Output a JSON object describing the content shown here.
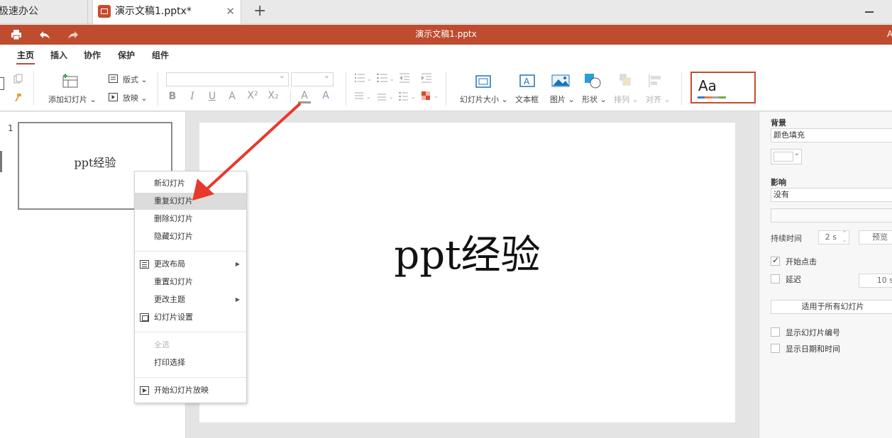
{
  "tabs": {
    "home_label": "极速办公",
    "doc_label": "演示文稿1.pptx*",
    "close_glyph": "✕",
    "add_glyph": "+"
  },
  "titlebar": {
    "title": "演示文稿1.pptx",
    "account_initial": "A",
    "color": "#bf4c2e"
  },
  "ribbon": {
    "tabs": [
      "主页",
      "插入",
      "协作",
      "保护",
      "组件"
    ],
    "active_tab": "主页"
  },
  "toolbar": {
    "add_slide": "添加幻灯片",
    "layout": "版式",
    "slideshow": "放映",
    "slide_size": "幻灯片大小",
    "text_box": "文本框",
    "picture": "图片",
    "shape": "形状",
    "arrange": "排列",
    "align": "对齐",
    "theme_text": "Aa"
  },
  "thumbnails": [
    {
      "number": "1",
      "text": "ppt经验"
    }
  ],
  "slide": {
    "text": "ppt经验"
  },
  "context_menu": {
    "items": [
      {
        "label": "新幻灯片"
      },
      {
        "label": "重复幻灯片",
        "highlighted": true
      },
      {
        "label": "删除幻灯片"
      },
      {
        "label": "隐藏幻灯片"
      },
      {
        "label": "更改布局",
        "icon": "layout-icon",
        "submenu": true
      },
      {
        "label": "重置幻灯片"
      },
      {
        "label": "更改主题",
        "submenu": true
      },
      {
        "label": "幻灯片设置",
        "icon": "slide-setup-icon"
      },
      {
        "label": "全选",
        "disabled": true
      },
      {
        "label": "打印选择"
      },
      {
        "label": "开始幻灯片放映",
        "icon": "play-icon"
      }
    ]
  },
  "right_panel": {
    "background_label": "背景",
    "background_fill": "颜色填充",
    "effect_label": "影响",
    "effect_value": "没有",
    "duration_label": "持续时间",
    "duration_value": "2 s",
    "preview_button": "预览",
    "start_on_click": "开始点击",
    "start_on_click_checked": true,
    "delay_label": "延迟",
    "delay_checked": false,
    "delay_value": "10 s",
    "apply_all_button": "适用于所有幻灯片",
    "show_slide_number": "显示幻灯片编号",
    "show_date_time": "显示日期和时间"
  },
  "annotation_color": "#e8392b"
}
